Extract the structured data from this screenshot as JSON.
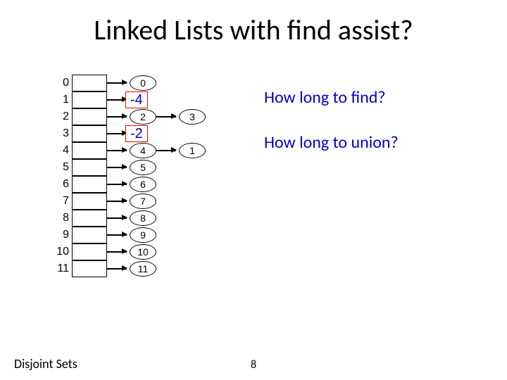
{
  "title": "Linked Lists with find assist?",
  "footer": "Disjoint Sets",
  "page_number": "8",
  "questions": {
    "q1": "How long to find?",
    "q2": "How long to union?"
  },
  "overlay": {
    "a": "-4",
    "b": "-2"
  },
  "indices": [
    "0",
    "1",
    "2",
    "3",
    "4",
    "5",
    "6",
    "7",
    "8",
    "9",
    "10",
    "11"
  ],
  "nodes": {
    "n0": "0",
    "n2": "2",
    "n3": "3",
    "n4": "4",
    "n1": "1",
    "n5": "5",
    "n6": "6",
    "n7": "7",
    "n8": "8",
    "n9": "9",
    "n10": "10",
    "n11": "11"
  }
}
